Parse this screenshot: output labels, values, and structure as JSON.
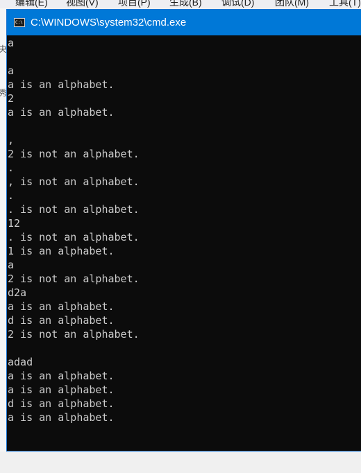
{
  "ide": {
    "menu_items": [
      "编辑(E)",
      "视图(V)",
      "项目(P)",
      "生成(B)",
      "调试(D)",
      "团队(M)",
      "工具(T)"
    ],
    "left_chars": [
      "夬",
      "秀"
    ]
  },
  "window": {
    "title": "C:\\WINDOWS\\system32\\cmd.exe",
    "icon_label": "C:\\"
  },
  "console": {
    "lines": [
      "a",
      "",
      "a",
      "a is an alphabet.",
      "2",
      "a is an alphabet.",
      "",
      ",",
      "2 is not an alphabet.",
      ".",
      ", is not an alphabet.",
      ".",
      ". is not an alphabet.",
      "12",
      ". is not an alphabet.",
      "1 is an alphabet.",
      "a",
      "2 is not an alphabet.",
      "d2a",
      "a is an alphabet.",
      "d is an alphabet.",
      "2 is not an alphabet.",
      "",
      "adad",
      "a is an alphabet.",
      "a is an alphabet.",
      "d is an alphabet.",
      "a is an alphabet."
    ]
  }
}
